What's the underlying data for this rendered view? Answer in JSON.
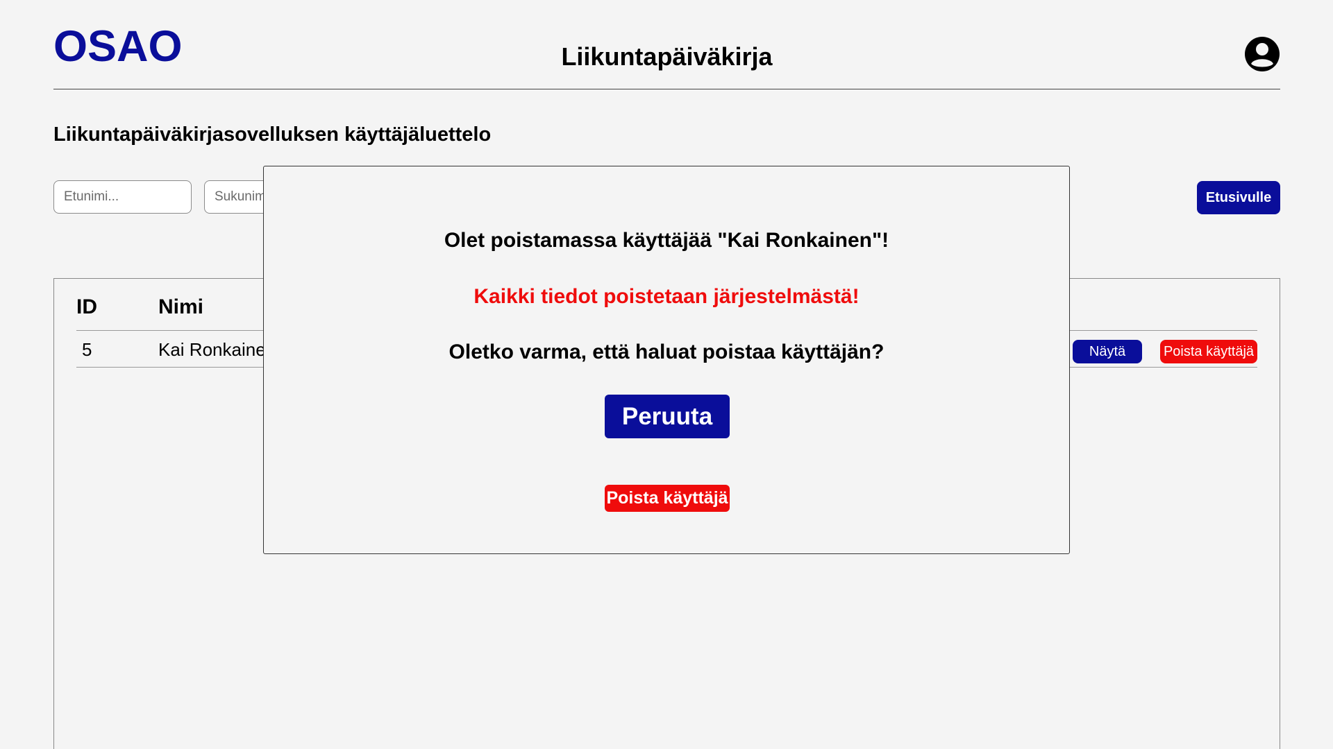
{
  "header": {
    "logo": "OSAO",
    "title": "Liikuntapäiväkirja",
    "user_icon": "account-circle-icon"
  },
  "page": {
    "heading": "Liikuntapäiväkirjasovelluksen käyttäjäluettelo"
  },
  "filters": {
    "first_name_placeholder": "Etunimi...",
    "last_name_placeholder": "Sukunimi...",
    "home_button": "Etusivulle"
  },
  "table": {
    "columns": [
      "ID",
      "Nimi"
    ],
    "rows": [
      {
        "id": "5",
        "name": "Kai Ronkainen",
        "show_label": "Näytä",
        "delete_label": "Poista käyttäjä"
      }
    ]
  },
  "modal": {
    "message": "Olet poistamassa käyttäjää \"Kai Ronkainen\"!",
    "warning": "Kaikki tiedot poistetaan järjestelmästä!",
    "question": "Oletko varma, että haluat poistaa käyttäjän?",
    "cancel_label": "Peruuta",
    "confirm_label": "Poista käyttäjä"
  },
  "colors": {
    "brand_blue": "#0a0e9a",
    "danger_red": "#ef0c0c",
    "background": "#f4f4f4"
  }
}
